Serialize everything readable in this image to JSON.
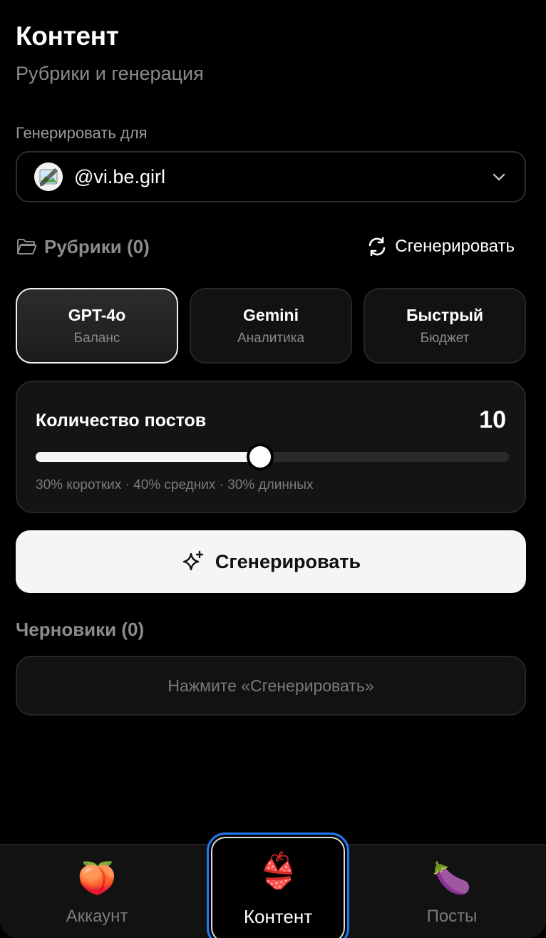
{
  "header": {
    "title": "Контент",
    "subtitle": "Рубрики и генерация"
  },
  "generate_for": {
    "label": "Генерировать для",
    "account": "@vi.be.girl"
  },
  "rubrics": {
    "title": "Рубрики (0)",
    "regenerate_label": "Сгенерировать"
  },
  "models": [
    {
      "name": "GPT-4o",
      "description": "Баланс",
      "selected": true
    },
    {
      "name": "Gemini",
      "description": "Аналитика",
      "selected": false
    },
    {
      "name": "Быстрый",
      "description": "Бюджет",
      "selected": false
    }
  ],
  "post_count": {
    "label": "Количество постов",
    "value": "10",
    "slider_fraction": 0.475,
    "hint": "30% коротких · 40% средних · 30% длинных"
  },
  "generate_button": {
    "label": "Сгенерировать"
  },
  "drafts": {
    "title": "Черновики (0)",
    "empty_hint": "Нажмите «Сгенерировать»"
  },
  "tabbar": {
    "tabs": [
      {
        "label": "Аккаунт",
        "emoji": "🍑",
        "active": false
      },
      {
        "label": "Контент",
        "emoji": "👙",
        "active": true
      },
      {
        "label": "Посты",
        "emoji": "🍆",
        "active": false
      }
    ]
  }
}
